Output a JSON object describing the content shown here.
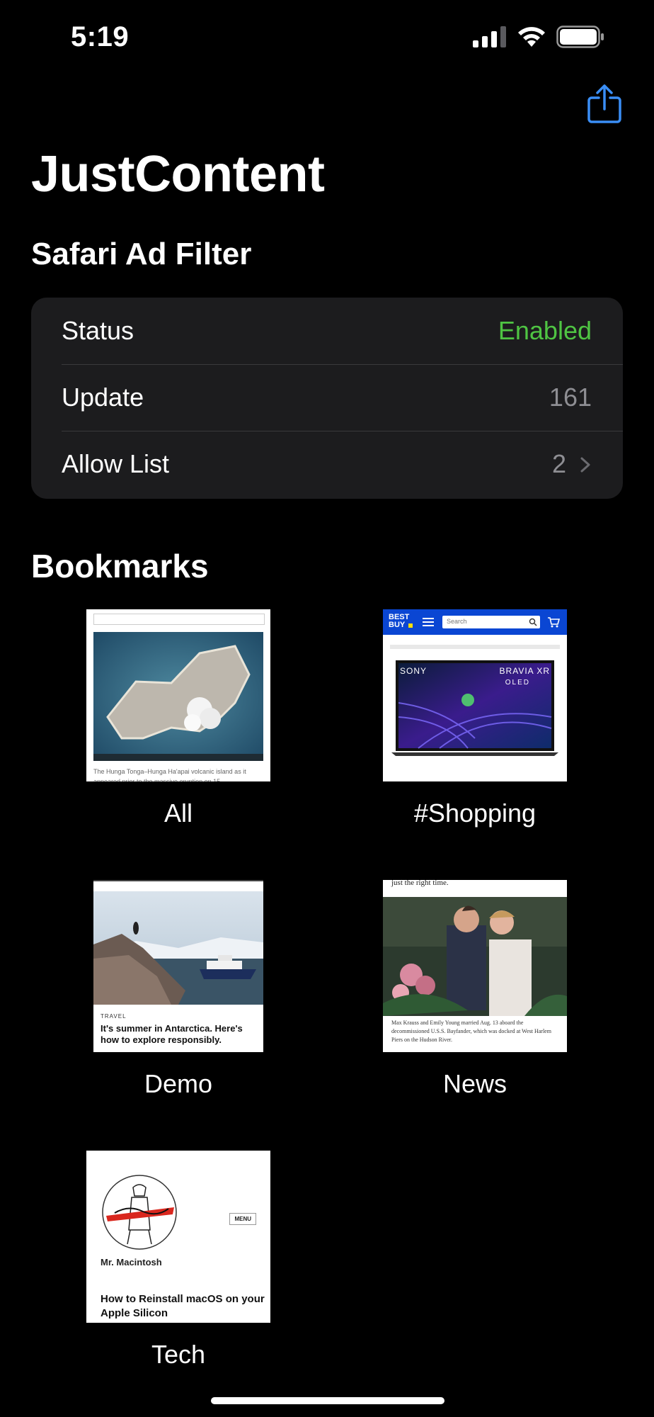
{
  "status_bar": {
    "time": "5:19"
  },
  "header": {
    "title": "JustContent",
    "subtitle": "Safari Ad Filter"
  },
  "filter_settings": {
    "rows": [
      {
        "label": "Status",
        "value": "Enabled"
      },
      {
        "label": "Update",
        "value": "161"
      },
      {
        "label": "Allow List",
        "value": "2"
      }
    ]
  },
  "bookmarks": {
    "title": "Bookmarks",
    "items": [
      {
        "label": "All",
        "caption": "The Hunga Tonga–Hunga Ha'apai volcanic island as it appeared prior to the massive eruption on 15"
      },
      {
        "label": "#Shopping",
        "brand": "BEST BUY",
        "search_placeholder": "Search",
        "product_brand": "SONY",
        "product_line": "BRAVIA XR",
        "product_sub": "OLED"
      },
      {
        "label": "Demo",
        "category": "TRAVEL",
        "headline": "It's summer in Antarctica. Here's how to explore responsibly."
      },
      {
        "label": "News",
        "top_text": "just the right time.",
        "caption": "Max Krauss and Emily Young married Aug. 13 aboard the decommissioned U.S.S. Bayfander, which was docked at West Harlem Piers on the Hudson River."
      },
      {
        "label": "Tech",
        "site": "Mr. Macintosh",
        "menu": "MENU",
        "headline": "How to Reinstall macOS on your Apple Silicon"
      }
    ]
  },
  "colors": {
    "enabled": "#4fc443",
    "accent": "#3a8ef6",
    "card_bg": "#1c1c1e"
  }
}
